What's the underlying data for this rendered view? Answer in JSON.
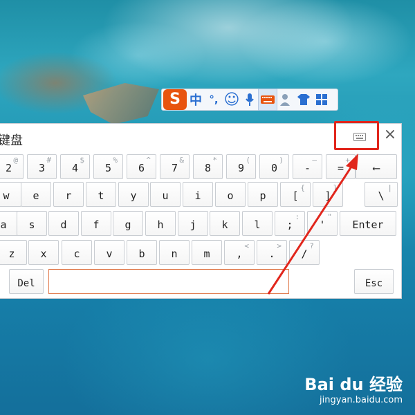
{
  "ime_toolbar": {
    "logo": "S",
    "items": [
      {
        "name": "chinese-mode",
        "glyph": "中"
      },
      {
        "name": "punctuation",
        "glyph": "°,"
      },
      {
        "name": "emoji",
        "glyph": "☺"
      },
      {
        "name": "voice",
        "glyph": "🎤"
      },
      {
        "name": "soft-keyboard",
        "glyph": "⌨"
      },
      {
        "name": "user",
        "glyph": "👤"
      },
      {
        "name": "skin",
        "glyph": "👕"
      },
      {
        "name": "toolbox",
        "glyph": "▦"
      }
    ]
  },
  "keyboard": {
    "title": "软键盘",
    "title_visible": "键盘",
    "close": "×",
    "rows": [
      [
        {
          "main": "2",
          "shift": "@"
        },
        {
          "main": "3",
          "shift": "#"
        },
        {
          "main": "4",
          "shift": "$"
        },
        {
          "main": "5",
          "shift": "%"
        },
        {
          "main": "6",
          "shift": "^"
        },
        {
          "main": "7",
          "shift": "&"
        },
        {
          "main": "8",
          "shift": "*"
        },
        {
          "main": "9",
          "shift": "("
        },
        {
          "main": "0",
          "shift": ")"
        },
        {
          "main": "-",
          "shift": "—"
        },
        {
          "main": "=",
          "shift": "+"
        },
        {
          "main": "⟵",
          "shift": ""
        }
      ],
      [
        {
          "main": "w",
          "shift": ""
        },
        {
          "main": "e",
          "shift": ""
        },
        {
          "main": "r",
          "shift": ""
        },
        {
          "main": "t",
          "shift": ""
        },
        {
          "main": "y",
          "shift": ""
        },
        {
          "main": "u",
          "shift": ""
        },
        {
          "main": "i",
          "shift": ""
        },
        {
          "main": "o",
          "shift": ""
        },
        {
          "main": "p",
          "shift": ""
        },
        {
          "main": "[",
          "shift": "{"
        },
        {
          "main": "]",
          "shift": "}"
        },
        {
          "main": "\\",
          "shift": "|"
        }
      ],
      [
        {
          "main": "a",
          "shift": ""
        },
        {
          "main": "s",
          "shift": ""
        },
        {
          "main": "d",
          "shift": ""
        },
        {
          "main": "f",
          "shift": ""
        },
        {
          "main": "g",
          "shift": ""
        },
        {
          "main": "h",
          "shift": ""
        },
        {
          "main": "j",
          "shift": ""
        },
        {
          "main": "k",
          "shift": ""
        },
        {
          "main": "l",
          "shift": ""
        },
        {
          "main": ";",
          "shift": ":"
        },
        {
          "main": "'",
          "shift": "\""
        },
        {
          "main": "Enter",
          "shift": ""
        }
      ],
      [
        {
          "main": "z",
          "shift": ""
        },
        {
          "main": "x",
          "shift": ""
        },
        {
          "main": "c",
          "shift": ""
        },
        {
          "main": "v",
          "shift": ""
        },
        {
          "main": "b",
          "shift": ""
        },
        {
          "main": "n",
          "shift": ""
        },
        {
          "main": "m",
          "shift": ""
        },
        {
          "main": ",",
          "shift": "<"
        },
        {
          "main": ".",
          "shift": ">"
        },
        {
          "main": "/",
          "shift": "?"
        }
      ]
    ],
    "del": "Del",
    "esc": "Esc"
  },
  "watermark": {
    "logo": "Bai du 经验",
    "url": "jingyan.baidu.com"
  },
  "colors": {
    "annotation": "#e1261c",
    "ime_logo": "#e8540f",
    "ime_icons": "#2a6fd1"
  }
}
